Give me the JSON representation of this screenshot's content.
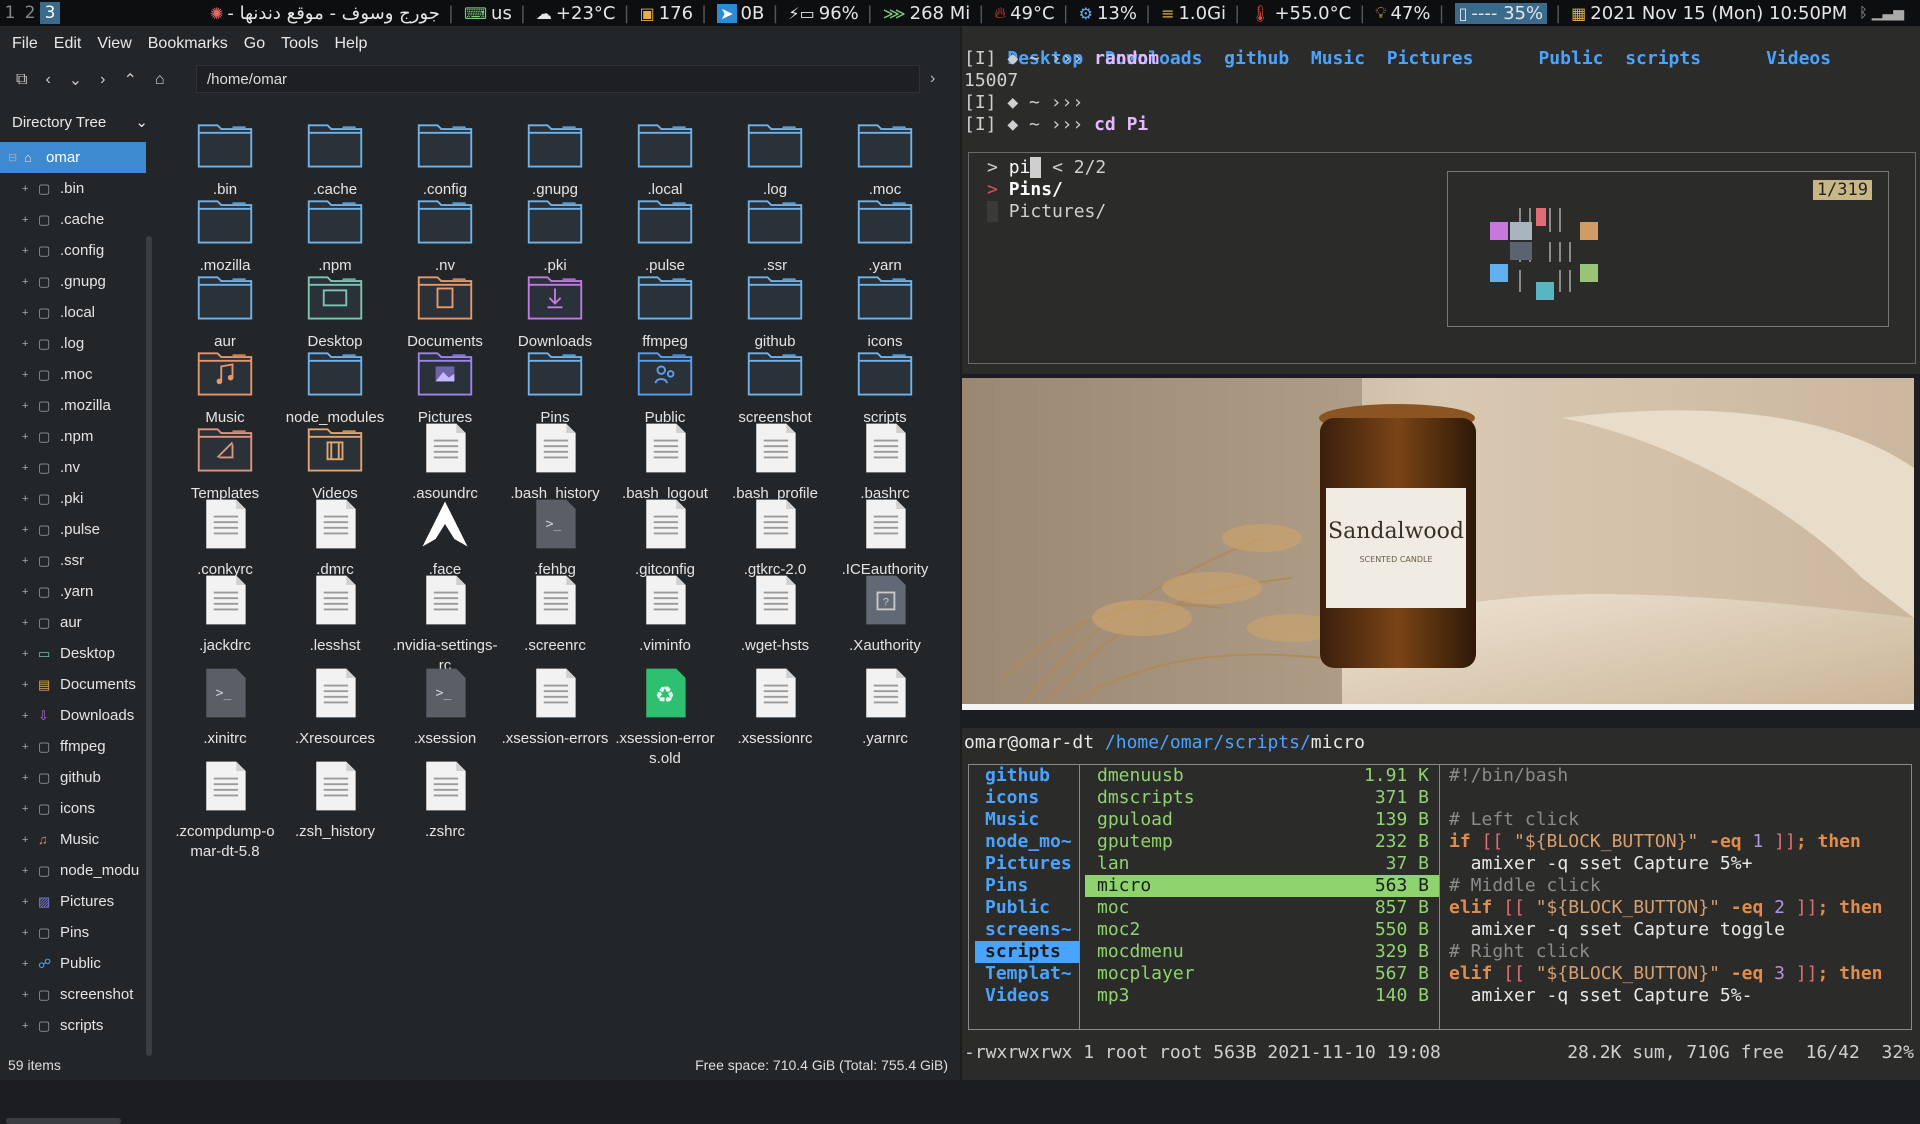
{
  "topbar": {
    "workspaces": [
      "1",
      "2",
      "3"
    ],
    "active_workspace": "3",
    "window_title": "جورج وسوف - موقع دندنها -",
    "keyboard": "us",
    "weather": "+23°C",
    "updates": "176",
    "notif": "0B",
    "battery": "96%",
    "network": "268 Mi",
    "gpu_temp": "49°C",
    "cpu": "13%",
    "memory": "1.0Gi",
    "cpu_temp": "+55.0°C",
    "brightness": "47%",
    "volume": "---- 35%",
    "datetime": "2021 Nov 15 (Mon) 10:50PM"
  },
  "filemanager": {
    "menu": [
      "File",
      "Edit",
      "View",
      "Bookmarks",
      "Go",
      "Tools",
      "Help"
    ],
    "location": "/home/omar",
    "sidebar_title": "Directory Tree",
    "tree_root": "omar",
    "tree": [
      ".bin",
      ".cache",
      ".config",
      ".gnupg",
      ".local",
      ".log",
      ".moc",
      ".mozilla",
      ".npm",
      ".nv",
      ".pki",
      ".pulse",
      ".ssr",
      ".yarn",
      "aur",
      "Desktop",
      "Documents",
      "Downloads",
      "ffmpeg",
      "github",
      "icons",
      "Music",
      "node_modu",
      "Pictures",
      "Pins",
      "Public",
      "screenshot",
      "scripts"
    ],
    "items": [
      {
        "name": ".bin",
        "type": "folder"
      },
      {
        "name": ".cache",
        "type": "folder"
      },
      {
        "name": ".config",
        "type": "folder"
      },
      {
        "name": ".gnupg",
        "type": "folder"
      },
      {
        "name": ".local",
        "type": "folder"
      },
      {
        "name": ".log",
        "type": "folder"
      },
      {
        "name": ".moc",
        "type": "folder"
      },
      {
        "name": ".mozilla",
        "type": "folder"
      },
      {
        "name": ".npm",
        "type": "folder"
      },
      {
        "name": ".nv",
        "type": "folder"
      },
      {
        "name": ".pki",
        "type": "folder"
      },
      {
        "name": ".pulse",
        "type": "folder"
      },
      {
        "name": ".ssr",
        "type": "folder"
      },
      {
        "name": ".yarn",
        "type": "folder"
      },
      {
        "name": "aur",
        "type": "folder"
      },
      {
        "name": "Desktop",
        "type": "folder-desktop"
      },
      {
        "name": "Documents",
        "type": "folder-documents"
      },
      {
        "name": "Downloads",
        "type": "folder-downloads"
      },
      {
        "name": "ffmpeg",
        "type": "folder"
      },
      {
        "name": "github",
        "type": "folder"
      },
      {
        "name": "icons",
        "type": "folder"
      },
      {
        "name": "Music",
        "type": "folder-music"
      },
      {
        "name": "node_modules",
        "type": "folder"
      },
      {
        "name": "Pictures",
        "type": "folder-pictures"
      },
      {
        "name": "Pins",
        "type": "folder"
      },
      {
        "name": "Public",
        "type": "folder-public"
      },
      {
        "name": "screenshot",
        "type": "folder"
      },
      {
        "name": "scripts",
        "type": "folder"
      },
      {
        "name": "Templates",
        "type": "folder-templates"
      },
      {
        "name": "Videos",
        "type": "folder-videos"
      },
      {
        "name": ".asoundrc",
        "type": "file"
      },
      {
        "name": ".bash_history",
        "type": "file"
      },
      {
        "name": ".bash_logout",
        "type": "file"
      },
      {
        "name": ".bash_profile",
        "type": "file"
      },
      {
        "name": ".bashrc",
        "type": "file"
      },
      {
        "name": ".conkyrc",
        "type": "file"
      },
      {
        "name": ".dmrc",
        "type": "file"
      },
      {
        "name": ".face",
        "type": "file-arch"
      },
      {
        "name": ".fehbg",
        "type": "file-script"
      },
      {
        "name": ".gitconfig",
        "type": "file"
      },
      {
        "name": ".gtkrc-2.0",
        "type": "file"
      },
      {
        "name": ".ICEauthority",
        "type": "file"
      },
      {
        "name": ".jackdrc",
        "type": "file"
      },
      {
        "name": ".lesshst",
        "type": "file"
      },
      {
        "name": ".nvidia-settings-rc",
        "type": "file"
      },
      {
        "name": ".screenrc",
        "type": "file"
      },
      {
        "name": ".viminfo",
        "type": "file"
      },
      {
        "name": ".wget-hsts",
        "type": "file"
      },
      {
        "name": ".Xauthority",
        "type": "file-unknown"
      },
      {
        "name": ".xinitrc",
        "type": "file-script"
      },
      {
        "name": ".Xresources",
        "type": "file"
      },
      {
        "name": ".xsession",
        "type": "file-script"
      },
      {
        "name": ".xsession-errors",
        "type": "file"
      },
      {
        "name": ".xsession-errors.old",
        "type": "file-recycle"
      },
      {
        "name": ".xsessionrc",
        "type": "file"
      },
      {
        "name": ".yarnrc",
        "type": "file"
      },
      {
        "name": ".zcompdump-omar-dt-5.8",
        "type": "file"
      },
      {
        "name": ".zsh_history",
        "type": "file"
      },
      {
        "name": ".zshrc",
        "type": "file"
      }
    ],
    "status_count": "59 items",
    "status_free": "Free space: 710.4 GiB (Total: 755.4 GiB)"
  },
  "term1": {
    "dirs": [
      "Desktop",
      "Downloads",
      "github",
      "Music",
      "Pictures",
      "Public",
      "scripts",
      "Videos"
    ],
    "prompt": "[I] ◆ ~ ›››",
    "cmd1": "random",
    "out1": "15007",
    "cmd2": "",
    "cmd3": "cd Pi",
    "fzf_query": "pi",
    "fzf_count": "< 2/2",
    "fzf_items": [
      "Pins/",
      "Pictures/"
    ],
    "preview_count": "1/319"
  },
  "photo": {
    "label": "Sandalwood",
    "sublabel": "SCENTED CANDLE"
  },
  "ranger": {
    "user_host": "omar@omar-dt",
    "path_prefix": "/home/omar/scripts/",
    "path_current": "micro",
    "col1": [
      "github",
      "icons",
      "Music",
      "node_mo~",
      "Pictures",
      "Pins",
      "Public",
      "screens~",
      "scripts",
      "Templat~",
      "Videos"
    ],
    "col1_selected": "scripts",
    "col2": [
      {
        "name": "dmenuusb",
        "size": "1.91 K"
      },
      {
        "name": "dmscripts",
        "size": "371 B"
      },
      {
        "name": "gpuload",
        "size": "139 B"
      },
      {
        "name": "gputemp",
        "size": "232 B"
      },
      {
        "name": "lan",
        "size": "37 B"
      },
      {
        "name": "micro",
        "size": "563 B"
      },
      {
        "name": "moc",
        "size": "857 B"
      },
      {
        "name": "moc2",
        "size": "550 B"
      },
      {
        "name": "mocdmenu",
        "size": "329 B"
      },
      {
        "name": "mocplayer",
        "size": "567 B"
      },
      {
        "name": "mp3",
        "size": "140 B"
      }
    ],
    "col2_selected": "micro",
    "code": {
      "shebang": "#!/bin/bash",
      "c1": "# Left click",
      "if1_a": "if [[ ",
      "if1_b": "\"${BLOCK_BUTTON}\"",
      "if1_c": " -eq ",
      "if1_d": "1",
      "if1_e": " ]]; then",
      "cmd1": "  amixer -q sset Capture 5%+",
      "c2": "# Middle click",
      "if2_a": "elif [[ ",
      "if2_d": "2",
      "cmd2": "  amixer -q sset Capture toggle",
      "c3": "# Right click",
      "if3_d": "3",
      "cmd3": "  amixer -q sset Capture 5%-"
    },
    "footer_left": "-rwxrwxrwx 1 root root 563B 2021-11-10 19:08",
    "footer_right": "28.2K sum, 710G free  16/42  32%"
  }
}
